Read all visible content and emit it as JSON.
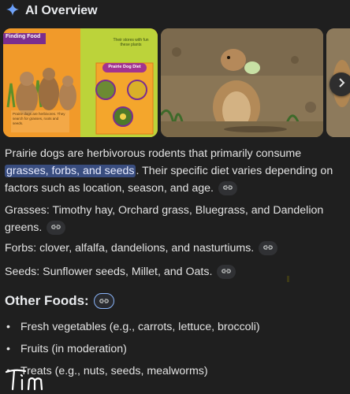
{
  "header": {
    "title": "AI Overview",
    "icon": "gemini-sparkle-icon"
  },
  "gallery": {
    "images": [
      {
        "name": "prairie-dog-diet-infographic",
        "banner": "Finding Food",
        "caption_top": "Their stores with fun these plants",
        "panel_title": "Prairie Dog Diet",
        "caption_bottom": "Prairie dogs are herbivores. They search for grasses, roots and seeds."
      },
      {
        "name": "prairie-dog-eating-photo"
      },
      {
        "name": "prairie-dog-photo-partial"
      }
    ],
    "next_icon": "chevron-right-icon"
  },
  "paragraphs": {
    "intro_before": "Prairie dogs are herbivorous rodents that primarily consume ",
    "intro_highlight": "grasses, forbs, and seeds",
    "intro_after": ". Their specific diet varies depending on factors such as location, season, and age.",
    "grasses": "Grasses: Timothy hay, Orchard grass, Bluegrass, and Dandelion greens.",
    "forbs": "Forbs: clover, alfalfa, dandelions, and nasturtiums.",
    "seeds": "Seeds: Sunflower seeds, Millet, and Oats."
  },
  "other_foods": {
    "heading": "Other Foods:",
    "bullet": "•",
    "items": [
      "Fresh vegetables (e.g., carrots, lettuce, broccoli)",
      "Fruits (in moderation)",
      "Treats (e.g., nuts, seeds, mealworms)"
    ]
  },
  "signature": "Tim",
  "colors": {
    "background": "#1f1f1f",
    "highlight": "#394d7f",
    "link_chip": "#303134",
    "accent": "#8ab4f8"
  }
}
